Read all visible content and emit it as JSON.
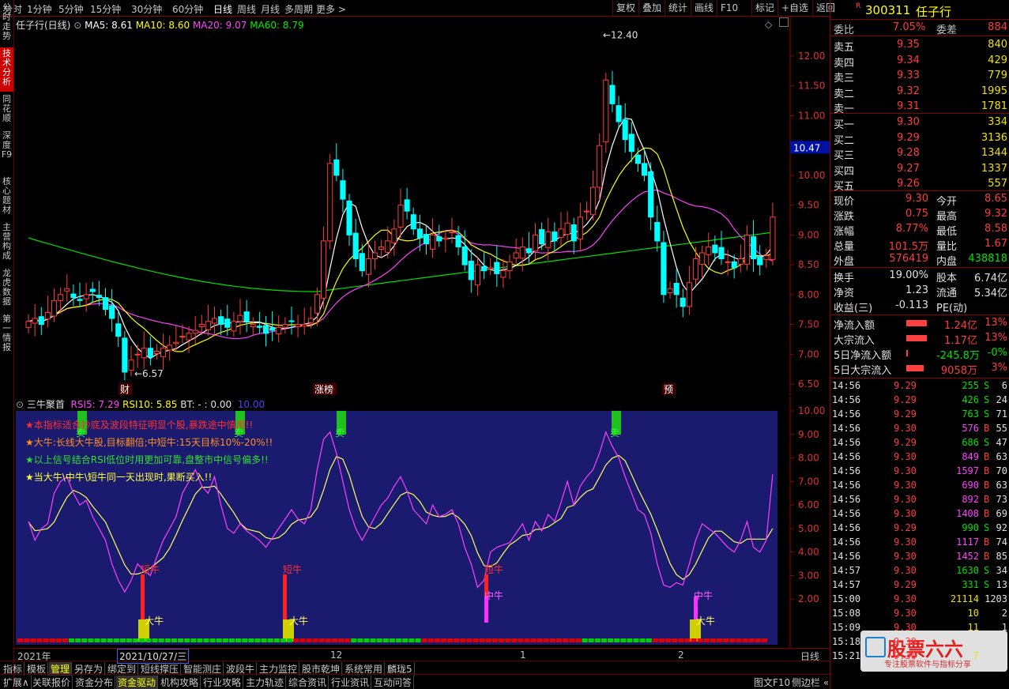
{
  "topbar": {
    "periods": [
      "分时",
      "1分钟",
      "5分钟",
      "15分钟",
      "30分钟",
      "60分钟",
      "日线",
      "周线",
      "月线",
      "多周期",
      "更多 >"
    ],
    "active": "日线",
    "tools": [
      "复权",
      "叠加",
      "统计",
      "画线",
      "F10",
      "标记",
      "+自选",
      "返回"
    ]
  },
  "leftnav": [
    "分时走势",
    "技术分析",
    "同花顺",
    "深度F9",
    "核心题材",
    "主营构成",
    "龙虎数据",
    "第一情报"
  ],
  "main_chart": {
    "title": "任子行(日线)",
    "ma5": "MA5: 8.61",
    "ma10": "MA10: 8.60",
    "ma20": "MA20: 9.07",
    "ma60": "MA60: 8.79",
    "high_label": "12.40",
    "low_label": "6.57",
    "price_tag": "10.47",
    "axis": [
      "12.00",
      "11.50",
      "11.00",
      "10.50",
      "10.00",
      "9.50",
      "9.00",
      "8.50",
      "8.00",
      "7.50",
      "7.00",
      "6.50"
    ],
    "markers": [
      "财",
      "涨榜",
      "预"
    ]
  },
  "sub_chart": {
    "title": "三牛聚首",
    "rsi5": "RSI5: 7.29",
    "rsi10": "RSI10: 5.85",
    "bt": "BT: - : 0.00",
    "level": "10.00",
    "notes": [
      "★本指标适合抄底及波段特征明显个股,暴跌途中慎用!!",
      "★大牛:长线大牛股,目标翻倍;中短牛:15天目标10%-20%!!",
      "★以上信号结合RSI低位时用更加可靠,盘整市中信号偏多!!",
      "★当大牛\\中牛\\短牛同一天出现时,果断买入!!"
    ],
    "axis": [
      "10.00",
      "9.00",
      "8.00",
      "7.00",
      "6.00",
      "5.00",
      "4.00",
      "3.00",
      "2.00"
    ],
    "sell_label": "卖",
    "labels": {
      "duan": "短牛",
      "zhong": "中牛",
      "da": "大牛"
    }
  },
  "dates": {
    "year": "2021年",
    "selected": "2021/10/27/三",
    "m12": "12",
    "m1": "1",
    "m2": "2",
    "mode": "日线"
  },
  "tabs1": [
    "指标",
    "模板",
    "管理",
    "另存为",
    "绑定到",
    "短线撑压",
    "智能测庄",
    "波段牛",
    "主力监控",
    "股市乾坤",
    "系统常用",
    "麟珑5"
  ],
  "tabs2": [
    "扩展∧",
    "关联报价",
    "资金分布",
    "资金驱动",
    "机构攻略",
    "行业攻略",
    "主力轨迹",
    "综合资讯",
    "行业资讯",
    "互动问答"
  ],
  "bottom_right": [
    "图文F10",
    "侧边栏 «"
  ],
  "quote": {
    "code": "300311",
    "name": "任子行",
    "weibi_label": "委比",
    "weibi": "7.05%",
    "weicha_label": "委差",
    "weicha": "884",
    "asks": [
      {
        "label": "卖五",
        "price": "9.35",
        "vol": "840"
      },
      {
        "label": "卖四",
        "price": "9.34",
        "vol": "429"
      },
      {
        "label": "卖三",
        "price": "9.33",
        "vol": "779"
      },
      {
        "label": "卖二",
        "price": "9.32",
        "vol": "1995"
      },
      {
        "label": "卖一",
        "price": "9.31",
        "vol": "1781"
      }
    ],
    "bids": [
      {
        "label": "买一",
        "price": "9.30",
        "vol": "334"
      },
      {
        "label": "买二",
        "price": "9.29",
        "vol": "3136"
      },
      {
        "label": "买三",
        "price": "9.28",
        "vol": "1344"
      },
      {
        "label": "买四",
        "price": "9.27",
        "vol": "1337"
      },
      {
        "label": "买五",
        "price": "9.26",
        "vol": "557"
      }
    ],
    "stats": [
      {
        "l1": "现价",
        "v1": "9.30",
        "l2": "今开",
        "v2": "8.65"
      },
      {
        "l1": "涨跌",
        "v1": "0.75",
        "l2": "最高",
        "v2": "9.32"
      },
      {
        "l1": "涨幅",
        "v1": "8.77%",
        "l2": "最低",
        "v2": "8.58"
      },
      {
        "l1": "总量",
        "v1": "101.5万",
        "l2": "量比",
        "v2": "1.67"
      },
      {
        "l1": "外盘",
        "v1": "576419",
        "l2": "内盘",
        "v2": "438818"
      }
    ],
    "stats2": [
      {
        "l1": "换手",
        "v1": "19.00%",
        "l2": "股本",
        "v2": "6.74亿"
      },
      {
        "l1": "净资",
        "v1": "1.23",
        "l2": "流通",
        "v2": "5.34亿"
      },
      {
        "l1": "收益(三)",
        "v1": "-0.113",
        "l2": "PE(动)",
        "v2": ""
      }
    ],
    "flows": [
      {
        "label": "净流入额",
        "value": "1.24亿",
        "pct": "13%"
      },
      {
        "label": "大宗流入",
        "value": "1.17亿",
        "pct": "13%"
      },
      {
        "label": "5日净流入额",
        "value": "-245.8万",
        "pct": "-0%"
      },
      {
        "label": "5日大宗流入",
        "value": "9058万",
        "pct": "3%"
      }
    ],
    "ticks": [
      {
        "t": "14:56",
        "p": "9.29",
        "v": "255",
        "s": "S",
        "n": "6"
      },
      {
        "t": "14:56",
        "p": "9.29",
        "v": "426",
        "s": "S",
        "n": "24"
      },
      {
        "t": "14:56",
        "p": "9.29",
        "v": "763",
        "s": "S",
        "n": "71"
      },
      {
        "t": "14:56",
        "p": "9.30",
        "v": "576",
        "s": "B",
        "n": "55"
      },
      {
        "t": "14:56",
        "p": "9.29",
        "v": "686",
        "s": "S",
        "n": "47"
      },
      {
        "t": "14:56",
        "p": "9.30",
        "v": "849",
        "s": "B",
        "n": "63"
      },
      {
        "t": "14:56",
        "p": "9.30",
        "v": "1597",
        "s": "B",
        "n": "70"
      },
      {
        "t": "14:56",
        "p": "9.30",
        "v": "690",
        "s": "B",
        "n": "63"
      },
      {
        "t": "14:56",
        "p": "9.30",
        "v": "892",
        "s": "B",
        "n": "73"
      },
      {
        "t": "14:56",
        "p": "9.30",
        "v": "1408",
        "s": "B",
        "n": "69"
      },
      {
        "t": "14:56",
        "p": "9.29",
        "v": "990",
        "s": "S",
        "n": "92"
      },
      {
        "t": "14:56",
        "p": "9.30",
        "v": "1117",
        "s": "B",
        "n": "74"
      },
      {
        "t": "14:56",
        "p": "9.30",
        "v": "1452",
        "s": "B",
        "n": "85"
      },
      {
        "t": "14:57",
        "p": "9.30",
        "v": "1630",
        "s": "S",
        "n": "34"
      },
      {
        "t": "14:57",
        "p": "9.29",
        "v": "331",
        "s": "S",
        "n": "13"
      },
      {
        "t": "15:00",
        "p": "9.30",
        "v": "21114",
        "s": "",
        "n": "1203"
      },
      {
        "t": "15:08",
        "p": "9.30",
        "v": "10",
        "s": "",
        "n": "2"
      },
      {
        "t": "15:09",
        "p": "9.30",
        "v": "11",
        "s": "",
        "n": "1"
      },
      {
        "t": "15:18",
        "p": "9.30",
        "v": "",
        "s": "",
        "n": ""
      },
      {
        "t": "15:21",
        "p": "9.30",
        "v": "7",
        "s": "",
        "n": ""
      }
    ],
    "watermark": "股票六六",
    "watermark_sub": "专注股票软件与指标分享"
  },
  "colors": {
    "up": "#ff3c3c",
    "down": "#00ffff",
    "ma5": "#ffffff",
    "ma10": "#ffff00",
    "ma20": "#ff40ff",
    "ma60": "#00e000",
    "sub_bg": "#1a1a6e"
  }
}
